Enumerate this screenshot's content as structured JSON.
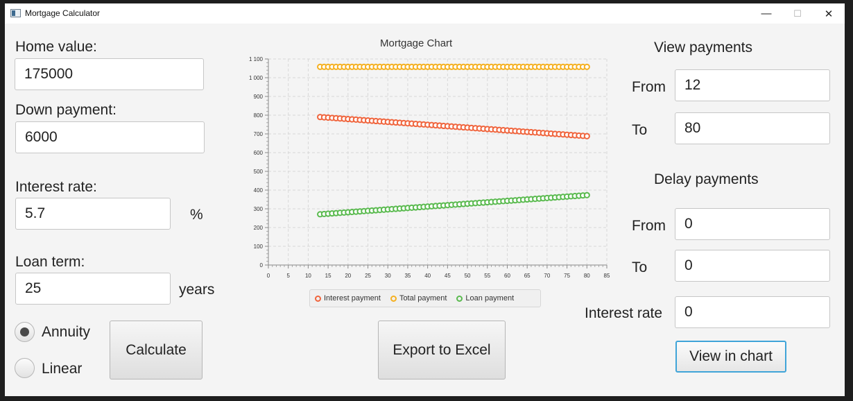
{
  "window": {
    "title": "Mortgage Calculator",
    "min_glyph": "—",
    "max_glyph": "☐",
    "close_glyph": "✕"
  },
  "left": {
    "home_value_label": "Home value:",
    "home_value": "175000",
    "down_payment_label": "Down payment:",
    "down_payment": "6000",
    "interest_rate_label": "Interest rate:",
    "interest_rate": "5.7",
    "percent": "%",
    "loan_term_label": "Loan term:",
    "loan_term": "25",
    "years": "years",
    "annuity_label": "Annuity",
    "annuity_selected": true,
    "linear_label": "Linear",
    "linear_selected": false,
    "calculate_label": "Calculate"
  },
  "center": {
    "export_label": "Export to Excel"
  },
  "right": {
    "view_payments_title": "View payments",
    "view_from_label": "From",
    "view_from": "12",
    "view_to_label": "To",
    "view_to": "80",
    "delay_payments_title": "Delay payments",
    "delay_from_label": "From",
    "delay_from": "0",
    "delay_to_label": "To",
    "delay_to": "0",
    "delay_rate_label": "Interest rate",
    "delay_rate": "0",
    "view_chart_label": "View in chart"
  },
  "chart_data": {
    "type": "scatter",
    "title": "Mortgage Chart",
    "xlabel": "",
    "ylabel": "",
    "xlim": [
      0,
      85
    ],
    "ylim": [
      0,
      1100
    ],
    "x_ticks": [
      "0",
      "5",
      "10",
      "15",
      "20",
      "25",
      "30",
      "35",
      "40",
      "45",
      "50",
      "55",
      "60",
      "65",
      "70",
      "75",
      "80",
      "85"
    ],
    "y_ticks": [
      "0",
      "100",
      "200",
      "300",
      "400",
      "500",
      "600",
      "700",
      "800",
      "900",
      "1 000",
      "1 100"
    ],
    "grid": true,
    "legend_position": "bottom",
    "x_start": 13,
    "x_end": 80,
    "series": [
      {
        "name": "Interest payment",
        "color": "#f0643c",
        "start": 790,
        "end": 688
      },
      {
        "name": "Total payment",
        "color": "#f5b020",
        "start": 1058,
        "end": 1058
      },
      {
        "name": "Loan payment",
        "color": "#5aba4f",
        "start": 271,
        "end": 373
      }
    ]
  }
}
